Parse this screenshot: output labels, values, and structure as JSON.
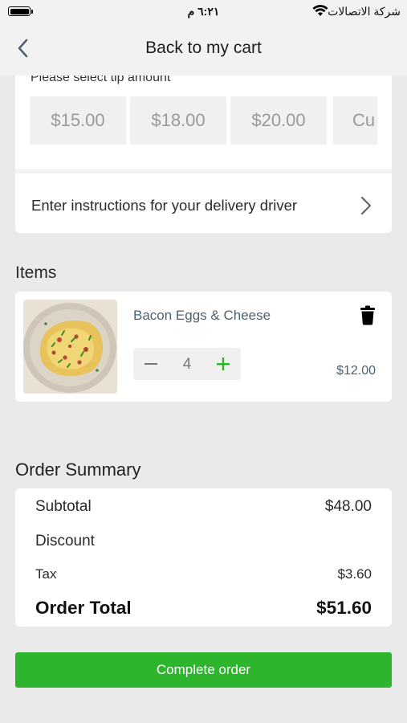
{
  "status_bar": {
    "time": "٦:٢١ م",
    "carrier": "شركة الاتصالات"
  },
  "header": {
    "title": "Back to my cart",
    "back_icon": "chevron-left-icon"
  },
  "tip": {
    "prompt": "Please select tip amount",
    "options": [
      "$15.00",
      "$18.00",
      "$20.00",
      "Cu"
    ]
  },
  "delivery": {
    "instructions_label": "Enter instructions for your delivery driver",
    "chevron_icon": "chevron-right-icon"
  },
  "items": {
    "heading": "Items",
    "list": [
      {
        "name": "Bacon Eggs & Cheese",
        "quantity": "4",
        "price": "$12.00",
        "image": "scrambled-eggs-plate",
        "delete_icon": "trash-icon"
      }
    ]
  },
  "summary": {
    "heading": "Order Summary",
    "subtotal_label": "Subtotal",
    "subtotal_value": "$48.00",
    "discount_label": "Discount",
    "discount_value": "",
    "tax_label": "Tax",
    "tax_value": "$3.60",
    "total_label": "Order Total",
    "total_value": "$51.60"
  },
  "actions": {
    "complete_label": "Complete order"
  },
  "colors": {
    "accent_green": "#2db52d",
    "item_text": "#4d6270",
    "background": "#eaeaea"
  }
}
